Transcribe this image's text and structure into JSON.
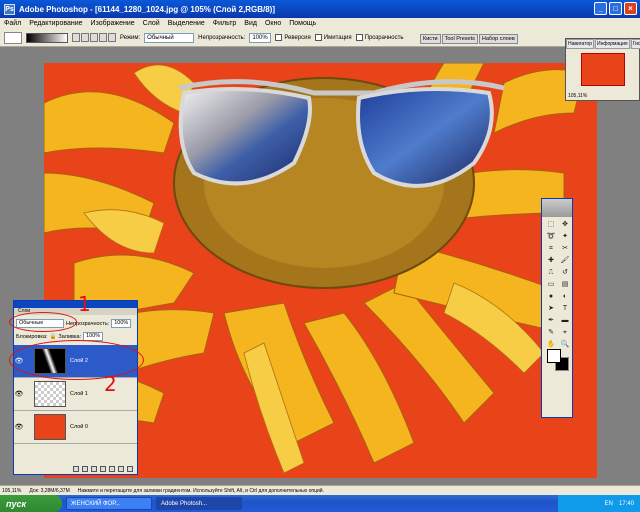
{
  "app": {
    "title": "Adobe Photoshop - [61144_1280_1024.jpg @ 105% (Слой 2,RGB/8)]"
  },
  "menu": [
    "Файл",
    "Редактирование",
    "Изображение",
    "Слой",
    "Выделение",
    "Фильтр",
    "Вид",
    "Окно",
    "Помощь"
  ],
  "options": {
    "mode_label": "Режим:",
    "mode_value": "Обычный",
    "opacity_label": "Непрозрачность:",
    "opacity_value": "100%",
    "reverse": "Реверсия",
    "dither": "Имитация",
    "transparency": "Прозрачность"
  },
  "tabs": [
    "Кисти",
    "Tool Presets",
    "Набор слоев"
  ],
  "navigator": {
    "tabs": [
      "Навигатор",
      "Информация",
      "Гистограмма"
    ],
    "zoom": "105,11%"
  },
  "layers_panel": {
    "title": "Слои",
    "tab": "Слои",
    "blend_mode": "Обычные",
    "opacity_label": "Непрозрачность:",
    "opacity_value": "100%",
    "lock_label": "Блокировка:",
    "fill_label": "Заливка:",
    "fill_value": "100%",
    "layers": [
      {
        "name": "Слой 2",
        "active": true
      },
      {
        "name": "Слой 1",
        "active": false
      },
      {
        "name": "Слой 0",
        "active": false
      }
    ]
  },
  "annotations": {
    "one": "1",
    "two": "2"
  },
  "status": {
    "zoom": "105,11%",
    "doc": "Док: 3,28М/6,37М",
    "hint": "Нажмите и перетащите для заливки градиентом. Используйте Shift, Alt, и Ctrl для дополнительных опций."
  },
  "taskbar": {
    "start": "пуск",
    "tasks": [
      "ЖЕНСКИЙ ФОР...",
      "Adobe Photosh..."
    ],
    "lang": "EN",
    "time": "17:40"
  },
  "colors": {
    "canvas_bg": "#e9431a",
    "xp_blue": "#0a46c0",
    "annotation_red": "#e01010"
  }
}
